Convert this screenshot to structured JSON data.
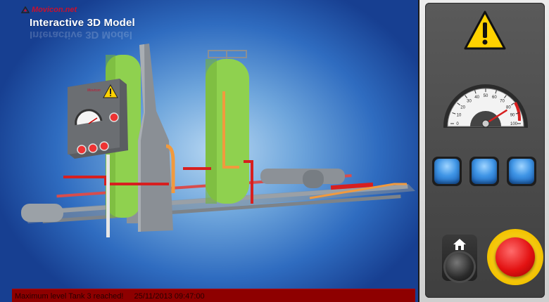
{
  "header": {
    "logo_text": "Movicon.net",
    "title": "Interactive 3D Model"
  },
  "status_bar": {
    "message": "Maximum level Tank 3 reached!",
    "timestamp": "25/11/2013 09:47:00"
  },
  "gauge": {
    "ticks": [
      "0",
      "10",
      "20",
      "30",
      "40",
      "50",
      "60",
      "70",
      "80",
      "90",
      "100"
    ],
    "value": 82
  },
  "colors": {
    "accent_red": "#c8102e",
    "tank_green": "#8fd14f",
    "alarm_bar": "#8e0000",
    "button_blue": "#3f95e6",
    "estop_yellow": "#f2c200"
  },
  "icons": [
    "warning-icon",
    "home-icon"
  ]
}
